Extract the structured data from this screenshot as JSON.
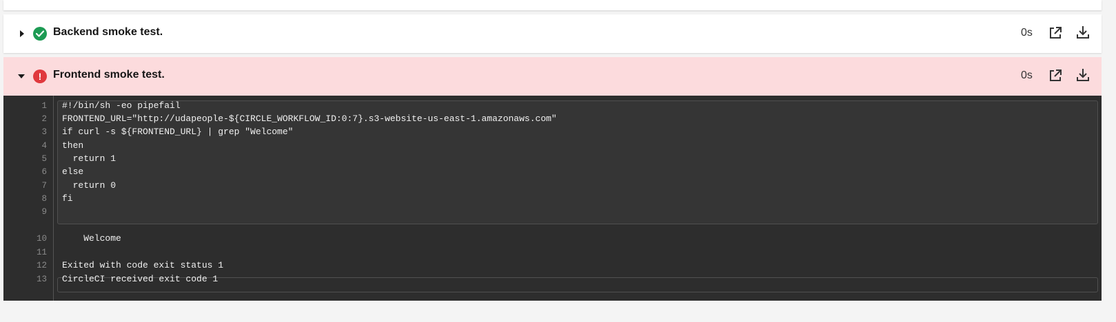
{
  "steps": [
    {
      "title": "Backend smoke test.",
      "status": "success",
      "duration": "0s",
      "expanded": false
    },
    {
      "title": "Frontend smoke test.",
      "status": "failed",
      "duration": "0s",
      "expanded": true
    }
  ],
  "status_icons": {
    "success": "check-circle-icon",
    "failed": "exclamation-circle-icon",
    "failed_glyph": "!"
  },
  "colors": {
    "success": "#1d9b54",
    "failed": "#e0393e",
    "failed_row_bg": "#fcdbdd",
    "terminal_bg": "#2d2d2d"
  },
  "terminal": {
    "lines": [
      {
        "n": "1",
        "text": "#!/bin/sh -eo pipefail"
      },
      {
        "n": "2",
        "text": "FRONTEND_URL=\"http://udapeople-${CIRCLE_WORKFLOW_ID:0:7}.s3-website-us-east-1.amazonaws.com\""
      },
      {
        "n": "3",
        "text": "if curl -s ${FRONTEND_URL} | grep \"Welcome\""
      },
      {
        "n": "4",
        "text": "then"
      },
      {
        "n": "5",
        "text": "  return 1"
      },
      {
        "n": "6",
        "text": "else"
      },
      {
        "n": "7",
        "text": "  return 0"
      },
      {
        "n": "8",
        "text": "fi"
      },
      {
        "n": "9",
        "text": ""
      },
      {
        "n": "10",
        "text": "    Welcome"
      },
      {
        "n": "11",
        "text": ""
      },
      {
        "n": "12",
        "text": "Exited with code exit status 1"
      },
      {
        "n": "13",
        "text": "CircleCI received exit code 1"
      }
    ]
  }
}
